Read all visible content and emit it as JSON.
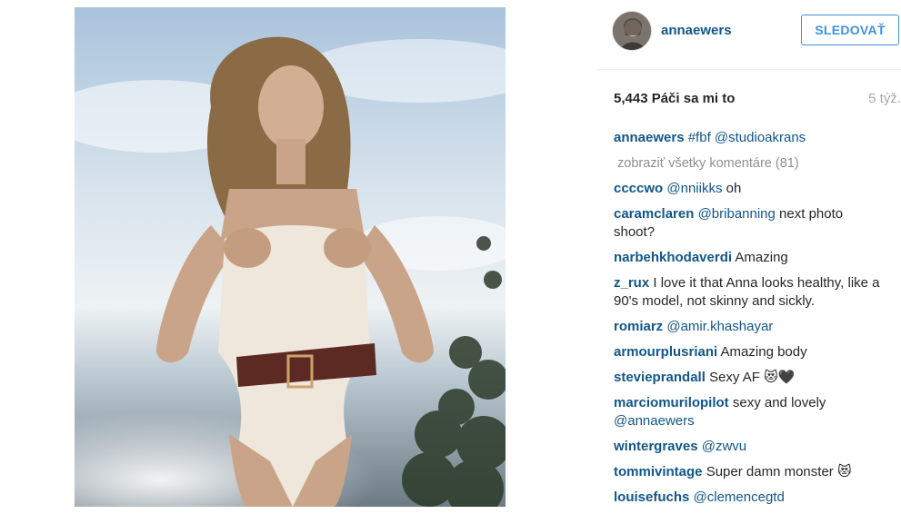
{
  "post": {
    "image_alt": "photo"
  },
  "header": {
    "username": "annaewers",
    "follow_label": "SLEDOVAŤ"
  },
  "stats": {
    "likes": "5,443 Páči sa mi to",
    "time_ago": "5 týž."
  },
  "caption": {
    "user": "annaewers",
    "text": "#fbf @studioakrans"
  },
  "view_all": "zobraziť všetky komentáre (81)",
  "comments": [
    {
      "user": "ccccwo",
      "text": "@nniikks oh"
    },
    {
      "user": "caramclaren",
      "text": "@bribanning next photo shoot?"
    },
    {
      "user": "narbehkhodaverdi",
      "text": "Amazing"
    },
    {
      "user": "z_rux",
      "text": "I love it that Anna looks healthy, like a 90's model, not skinny and sickly."
    },
    {
      "user": "romiarz",
      "text": "@amir.khashayar"
    },
    {
      "user": "armourplusriani",
      "text": "Amazing body"
    },
    {
      "user": "stevieprandall",
      "text": "Sexy AF 😻🖤"
    },
    {
      "user": "marciomurilopilot",
      "text": "sexy and lovely @annaewers"
    },
    {
      "user": "wintergraves",
      "text": "@zwvu"
    },
    {
      "user": "tommivintage",
      "text": "Super damn monster 😻"
    },
    {
      "user": "louisefuchs",
      "text": "@clemencegtd"
    }
  ]
}
